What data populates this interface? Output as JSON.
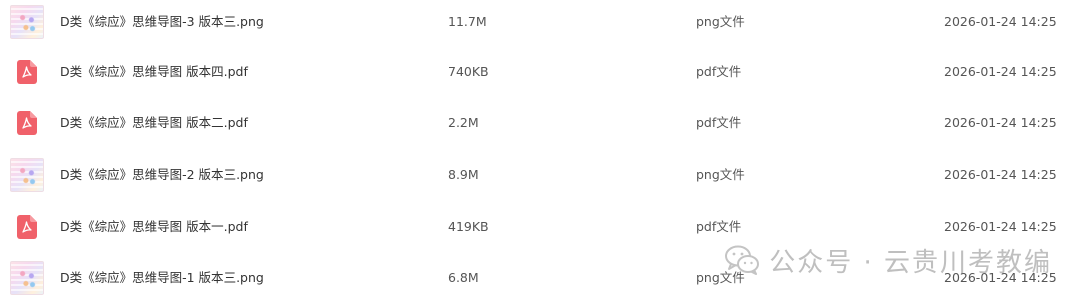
{
  "files": [
    {
      "name": "D类《综应》思维导图-3 版本三.png",
      "size": "11.7M",
      "type": "png文件",
      "date": "2026-01-24 14:25",
      "icon": "image-thumbnail"
    },
    {
      "name": "D类《综应》思维导图 版本四.pdf",
      "size": "740KB",
      "type": "pdf文件",
      "date": "2026-01-24 14:25",
      "icon": "pdf-icon"
    },
    {
      "name": "D类《综应》思维导图 版本二.pdf",
      "size": "2.2M",
      "type": "pdf文件",
      "date": "2026-01-24 14:25",
      "icon": "pdf-icon"
    },
    {
      "name": "D类《综应》思维导图-2 版本三.png",
      "size": "8.9M",
      "type": "png文件",
      "date": "2026-01-24 14:25",
      "icon": "image-thumbnail"
    },
    {
      "name": "D类《综应》思维导图 版本一.pdf",
      "size": "419KB",
      "type": "pdf文件",
      "date": "2026-01-24 14:25",
      "icon": "pdf-icon"
    },
    {
      "name": "D类《综应》思维导图-1 版本三.png",
      "size": "6.8M",
      "type": "png文件",
      "date": "2026-01-24 14:25",
      "icon": "image-thumbnail"
    }
  ],
  "watermark": {
    "text": "公众号 · 云贵川考教编",
    "icon": "wechat-icon"
  },
  "colors": {
    "pdf_red": "#f0616a",
    "text": "#333333",
    "watermark": "#c8c8c8"
  }
}
